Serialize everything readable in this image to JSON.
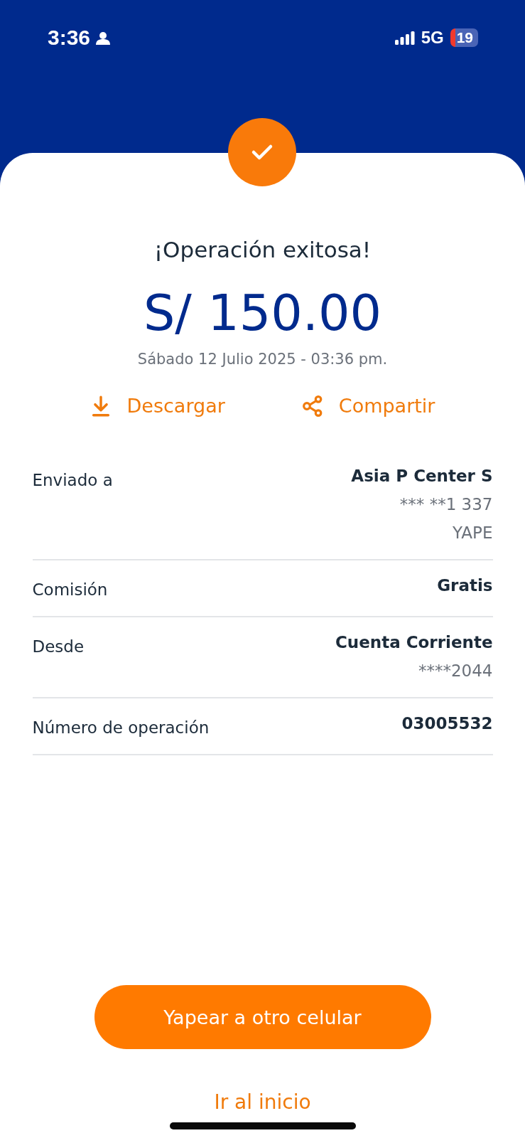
{
  "status_bar": {
    "time": "3:36",
    "network": "5G",
    "battery": "19"
  },
  "title": "¡Operación exitosa!",
  "amount": "S/ 150.00",
  "date": "Sábado 12 Julio 2025 - 03:36 pm.",
  "actions": [
    {
      "kind": "download",
      "label": "Descargar"
    },
    {
      "kind": "share",
      "label": "Compartir"
    }
  ],
  "details": [
    {
      "label": "Enviado a",
      "values": [
        "Asia P Center S",
        "*** **1 337",
        "YAPE"
      ]
    },
    {
      "label": "Comisión",
      "values": [
        "Gratis"
      ]
    },
    {
      "label": "Desde",
      "values": [
        "Cuenta Corriente",
        "****2044"
      ]
    },
    {
      "label": "Número de operación",
      "values": [
        "03005532"
      ]
    }
  ],
  "primary_button": "Yapear a otro celular",
  "link": "Ir al inicio"
}
